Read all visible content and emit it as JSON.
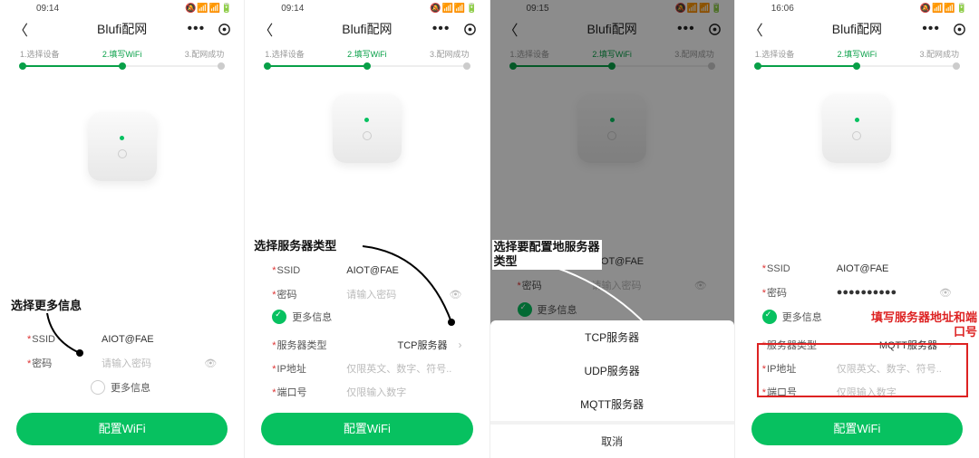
{
  "status": {
    "t1": "09:14",
    "t2": "09:14",
    "t3": "09:15",
    "t4": "16:06",
    "icons": "🔕 📶 📶 🔋"
  },
  "nav": {
    "title": "Blufi配网"
  },
  "steps": {
    "s1": "1.选择设备",
    "s2": "2.填写WiFi",
    "s3": "3.配网成功"
  },
  "fields": {
    "ssid_label": "SSID",
    "ssid_value": "AIOT@FAE",
    "pwd_label": "密码",
    "pwd_ph": "请输入密码",
    "pwd_mask": "●●●●●●●●●●",
    "more": "更多信息",
    "server_type_label": "服务器类型",
    "server_type_value": "TCP服务器",
    "server_type_value4": "MQTT服务器",
    "ip_label": "IP地址",
    "ip_ph": "仅限英文、数字、符号..",
    "port_label": "端口号",
    "port_ph": "仅限输入数字"
  },
  "sheet": {
    "o1": "TCP服务器",
    "o2": "UDP服务器",
    "o3": "MQTT服务器",
    "cancel": "取消"
  },
  "btn": {
    "config": "配置WiFi"
  },
  "anno": {
    "a1": "选择更多信息",
    "a1b": "信息",
    "a2": "选择服务器类型",
    "a3a": "选择要配置地服务器",
    "a3b": "类型",
    "a4a": "填写服务器地址和端",
    "a4b": "口号"
  }
}
